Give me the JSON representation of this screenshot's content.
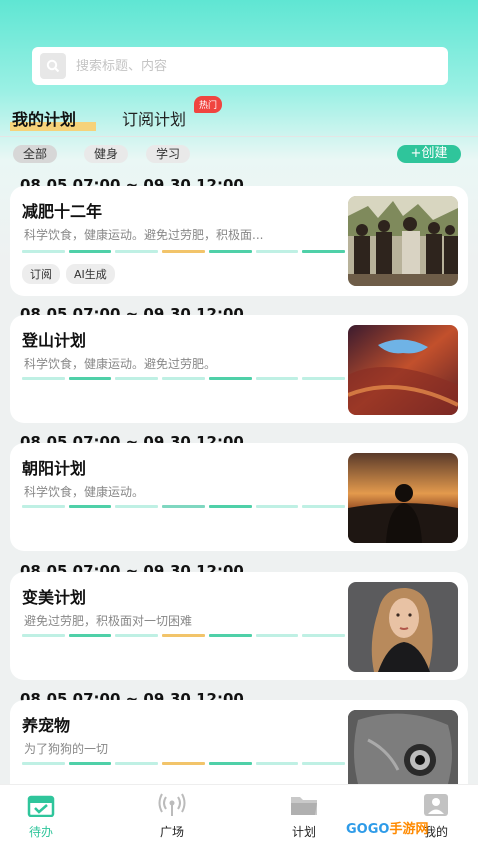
{
  "search": {
    "placeholder": "搜索标题、内容",
    "icon": "search-icon"
  },
  "tabs": [
    {
      "label": "我的计划",
      "active": true
    },
    {
      "label": "订阅计划",
      "badge": "热门"
    }
  ],
  "filters": {
    "chips": [
      "全部",
      "健身",
      "学习"
    ],
    "active": "全部",
    "create_label": "+创建"
  },
  "colors": {
    "accent": "#2fc59b",
    "hot": "#f04540",
    "bar_light": "#bff0e4",
    "bar_mid": "#4fd0a8",
    "bar_gold": "#f2c46a"
  },
  "plans": [
    {
      "date": "08.05 07:00 ~ 09.30 12:00",
      "title": "减肥十二年",
      "desc": "科学饮食，健康运动。避免过劳肥，积极面...",
      "tags": [
        "订阅",
        "AI生成"
      ],
      "image": "group-of-people-photo"
    },
    {
      "date": "08.05 07:00 ~ 09.30 12:00",
      "title": "登山计划",
      "desc": "科学饮食，健康运动。避免过劳肥。",
      "tags": [],
      "image": "canyon-rock-photo"
    },
    {
      "date": "08.05 07:00 ~ 09.30 12:00",
      "title": "朝阳计划",
      "desc": "科学饮食，健康运动。",
      "tags": [],
      "image": "sunset-silhouette-photo"
    },
    {
      "date": "08.05 07:00 ~ 09.30 12:00",
      "title": "变美计划",
      "desc": "避免过劳肥，积极面对一切困难",
      "tags": [],
      "image": "portrait-woman-photo"
    },
    {
      "date": "08.05 07:00 ~ 09.30 12:00",
      "title": "养宠物",
      "desc": "为了狗狗的一切",
      "tags": [],
      "image": "owl-face-photo"
    }
  ],
  "bottom_nav": [
    {
      "label": "待办",
      "icon": "calendar-icon",
      "active": true
    },
    {
      "label": "广场",
      "icon": "broadcast-icon"
    },
    {
      "label": "计划",
      "icon": "folder-icon"
    },
    {
      "label": "我的",
      "icon": "profile-icon"
    }
  ],
  "watermark": {
    "text_a": "GOGO",
    "text_b": "手游网"
  }
}
